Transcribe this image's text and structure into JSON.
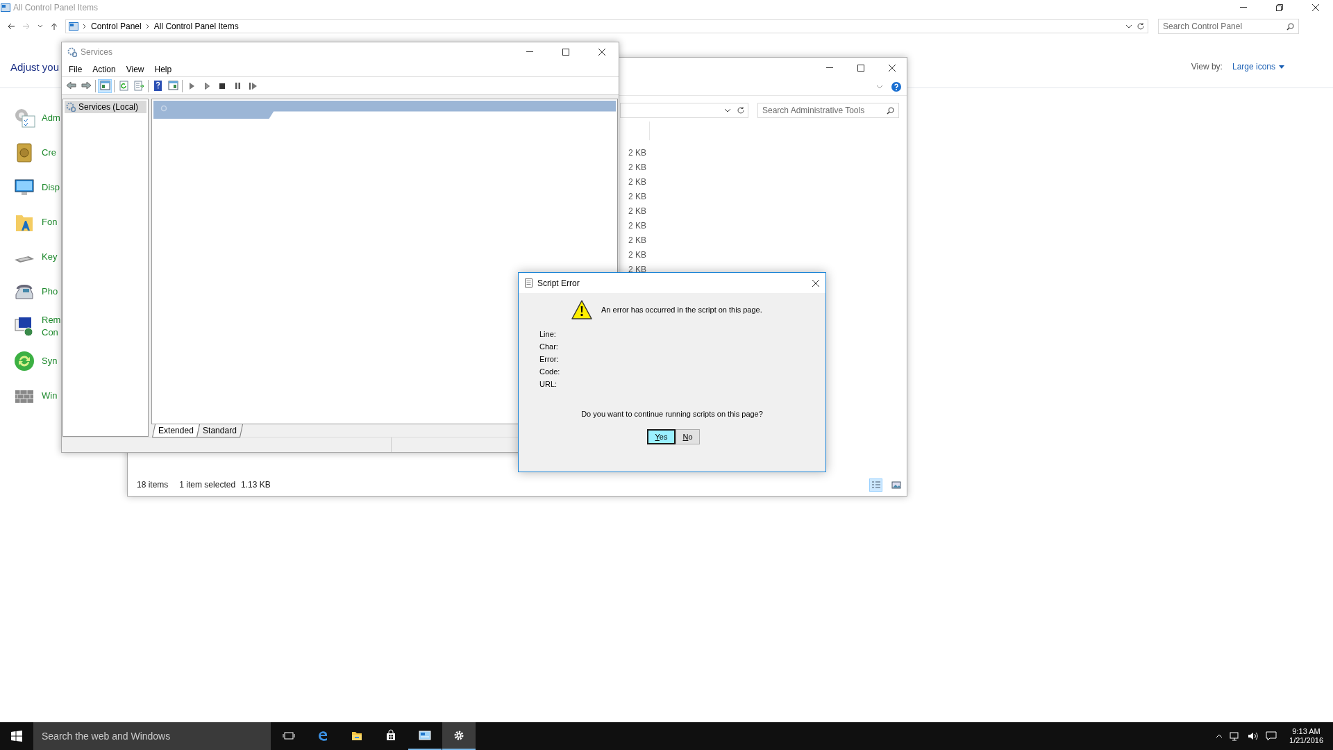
{
  "control_panel": {
    "title": "All Control Panel Items",
    "breadcrumb": [
      "Control Panel",
      "All Control Panel Items"
    ],
    "search": {
      "placeholder": "Search Control Panel"
    },
    "heading": "Adjust you",
    "view_by": {
      "label": "View by:",
      "value": "Large icons"
    },
    "items": [
      {
        "lines": [
          "Adm"
        ]
      },
      {
        "lines": [
          "Cre"
        ]
      },
      {
        "lines": [
          "Disp"
        ]
      },
      {
        "lines": [
          "Fon"
        ]
      },
      {
        "lines": [
          "Key"
        ]
      },
      {
        "lines": [
          "Pho"
        ]
      },
      {
        "lines": [
          "Rem",
          "Con"
        ]
      },
      {
        "lines": [
          "Syn"
        ]
      },
      {
        "lines": [
          "Win"
        ]
      }
    ]
  },
  "admin_tools": {
    "search": {
      "placeholder": "Search Administrative Tools"
    },
    "sizes": [
      "2 KB",
      "2 KB",
      "2 KB",
      "2 KB",
      "2 KB",
      "2 KB",
      "2 KB",
      "2 KB",
      "2 KB"
    ],
    "status": {
      "count": "18 items",
      "selection": "1 item selected",
      "size": "1.13 KB"
    },
    "view_buttons": [
      {
        "kind": "details",
        "selected": true
      },
      {
        "kind": "large-icons",
        "selected": false
      }
    ]
  },
  "services": {
    "title": "Services",
    "menu": [
      "File",
      "Action",
      "View",
      "Help"
    ],
    "toolbar": [
      [
        {
          "kind": "back",
          "pressed": false
        },
        {
          "kind": "forward",
          "pressed": false
        }
      ],
      [
        {
          "kind": "console-tree",
          "pressed": true
        }
      ],
      [
        {
          "kind": "refresh",
          "pressed": false
        },
        {
          "kind": "export",
          "pressed": false
        }
      ],
      [
        {
          "kind": "help",
          "pressed": false
        },
        {
          "kind": "action-pane",
          "pressed": false
        }
      ],
      [
        {
          "kind": "play",
          "pressed": false
        },
        {
          "kind": "play-outline",
          "pressed": false
        },
        {
          "kind": "stop",
          "pressed": false
        },
        {
          "kind": "pause",
          "pressed": false
        },
        {
          "kind": "resume",
          "pressed": false
        }
      ]
    ],
    "tree": [
      {
        "label": "Services (Local)",
        "selected": true
      }
    ],
    "tabs": [
      {
        "label": "Extended",
        "selected": true
      },
      {
        "label": "Standard",
        "selected": false
      }
    ]
  },
  "dialog": {
    "title": "Script Error",
    "message": "An error has occurred in the script on this page.",
    "fields": [
      "Line:",
      "Char:",
      "Error:",
      "Code:",
      "URL:"
    ],
    "question": "Do you want to continue running scripts on this page?",
    "buttons": [
      {
        "label": "Yes",
        "default": true
      },
      {
        "label": "No",
        "default": false
      }
    ]
  },
  "taskbar": {
    "search": {
      "placeholder": "Search the web and Windows"
    },
    "apps": [
      {
        "kind": "task-view",
        "running": false,
        "selected": false
      },
      {
        "kind": "browser",
        "running": false,
        "selected": false
      },
      {
        "kind": "folder",
        "running": false,
        "selected": false
      },
      {
        "kind": "store",
        "running": false,
        "selected": false
      },
      {
        "kind": "control-panel",
        "running": true,
        "selected": false
      },
      {
        "kind": "gear",
        "running": true,
        "selected": true
      }
    ],
    "clock": {
      "time": "9:13 AM",
      "date": "1/21/2016"
    }
  }
}
